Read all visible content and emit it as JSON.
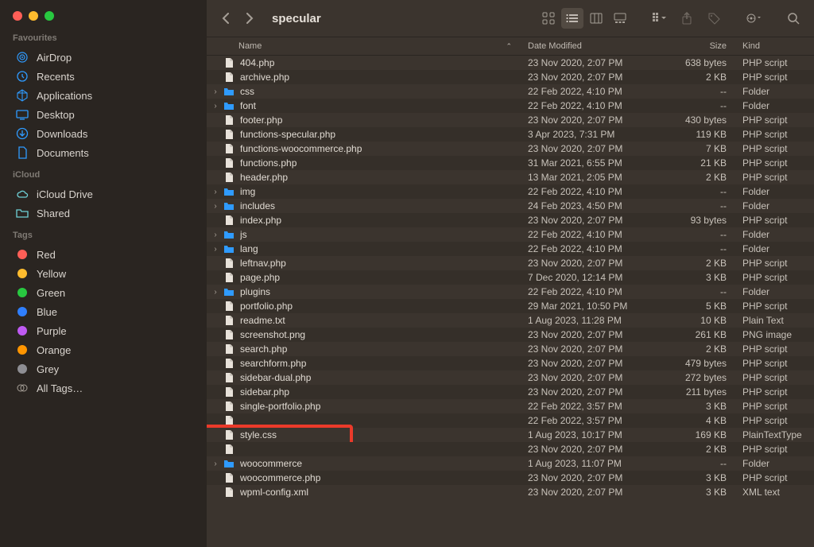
{
  "traffic": {
    "close": "#ff5f57",
    "min": "#febc2e",
    "max": "#28c840"
  },
  "sidebar": {
    "sections": [
      {
        "label": "Favourites",
        "items": [
          {
            "name": "AirDrop",
            "icon": "airdrop",
            "color": "#2f9bff"
          },
          {
            "name": "Recents",
            "icon": "clock",
            "color": "#2f9bff"
          },
          {
            "name": "Applications",
            "icon": "apps",
            "color": "#2f9bff"
          },
          {
            "name": "Desktop",
            "icon": "desktop",
            "color": "#2f9bff"
          },
          {
            "name": "Downloads",
            "icon": "download",
            "color": "#2f9bff"
          },
          {
            "name": "Documents",
            "icon": "document",
            "color": "#2f9bff"
          }
        ]
      },
      {
        "label": "iCloud",
        "items": [
          {
            "name": "iCloud Drive",
            "icon": "cloud",
            "color": "#6fd2d8"
          },
          {
            "name": "Shared",
            "icon": "folder",
            "color": "#6fd2d8"
          }
        ]
      },
      {
        "label": "Tags",
        "items": [
          {
            "name": "Red",
            "icon": "tag",
            "color": "#ff5f57"
          },
          {
            "name": "Yellow",
            "icon": "tag",
            "color": "#febc2e"
          },
          {
            "name": "Green",
            "icon": "tag",
            "color": "#28c840"
          },
          {
            "name": "Blue",
            "icon": "tag",
            "color": "#2f7fff"
          },
          {
            "name": "Purple",
            "icon": "tag",
            "color": "#bf5af2"
          },
          {
            "name": "Orange",
            "icon": "tag",
            "color": "#ff9500"
          },
          {
            "name": "Grey",
            "icon": "tag",
            "color": "#8e8e93"
          },
          {
            "name": "All Tags…",
            "icon": "alltags",
            "color": "#a69f97"
          }
        ]
      }
    ]
  },
  "toolbar": {
    "title": "specular"
  },
  "columns": {
    "name": "Name",
    "date": "Date Modified",
    "size": "Size",
    "kind": "Kind"
  },
  "files": [
    {
      "name": "404.php",
      "date": "23 Nov 2020, 2:07 PM",
      "size": "638 bytes",
      "kind": "PHP script",
      "type": "file"
    },
    {
      "name": "archive.php",
      "date": "23 Nov 2020, 2:07 PM",
      "size": "2 KB",
      "kind": "PHP script",
      "type": "file"
    },
    {
      "name": "css",
      "date": "22 Feb 2022, 4:10 PM",
      "size": "--",
      "kind": "Folder",
      "type": "folder",
      "disclosure": true
    },
    {
      "name": "font",
      "date": "22 Feb 2022, 4:10 PM",
      "size": "--",
      "kind": "Folder",
      "type": "folder",
      "disclosure": true
    },
    {
      "name": "footer.php",
      "date": "23 Nov 2020, 2:07 PM",
      "size": "430 bytes",
      "kind": "PHP script",
      "type": "file"
    },
    {
      "name": "functions-specular.php",
      "date": "3 Apr 2023, 7:31 PM",
      "size": "119 KB",
      "kind": "PHP script",
      "type": "file"
    },
    {
      "name": "functions-woocommerce.php",
      "date": "23 Nov 2020, 2:07 PM",
      "size": "7 KB",
      "kind": "PHP script",
      "type": "file"
    },
    {
      "name": "functions.php",
      "date": "31 Mar 2021, 6:55 PM",
      "size": "21 KB",
      "kind": "PHP script",
      "type": "file"
    },
    {
      "name": "header.php",
      "date": "13 Mar 2021, 2:05 PM",
      "size": "2 KB",
      "kind": "PHP script",
      "type": "file"
    },
    {
      "name": "img",
      "date": "22 Feb 2022, 4:10 PM",
      "size": "--",
      "kind": "Folder",
      "type": "folder",
      "disclosure": true
    },
    {
      "name": "includes",
      "date": "24 Feb 2023, 4:50 PM",
      "size": "--",
      "kind": "Folder",
      "type": "folder",
      "disclosure": true
    },
    {
      "name": "index.php",
      "date": "23 Nov 2020, 2:07 PM",
      "size": "93 bytes",
      "kind": "PHP script",
      "type": "file"
    },
    {
      "name": "js",
      "date": "22 Feb 2022, 4:10 PM",
      "size": "--",
      "kind": "Folder",
      "type": "folder",
      "disclosure": true
    },
    {
      "name": "lang",
      "date": "22 Feb 2022, 4:10 PM",
      "size": "--",
      "kind": "Folder",
      "type": "folder",
      "disclosure": true
    },
    {
      "name": "leftnav.php",
      "date": "23 Nov 2020, 2:07 PM",
      "size": "2 KB",
      "kind": "PHP script",
      "type": "file"
    },
    {
      "name": "page.php",
      "date": "7 Dec 2020, 12:14 PM",
      "size": "3 KB",
      "kind": "PHP script",
      "type": "file"
    },
    {
      "name": "plugins",
      "date": "22 Feb 2022, 4:10 PM",
      "size": "--",
      "kind": "Folder",
      "type": "folder",
      "disclosure": true
    },
    {
      "name": "portfolio.php",
      "date": "29 Mar 2021, 10:50 PM",
      "size": "5 KB",
      "kind": "PHP script",
      "type": "file"
    },
    {
      "name": "readme.txt",
      "date": "1 Aug 2023, 11:28 PM",
      "size": "10 KB",
      "kind": "Plain Text",
      "type": "file"
    },
    {
      "name": "screenshot.png",
      "date": "23 Nov 2020, 2:07 PM",
      "size": "261 KB",
      "kind": "PNG image",
      "type": "file"
    },
    {
      "name": "search.php",
      "date": "23 Nov 2020, 2:07 PM",
      "size": "2 KB",
      "kind": "PHP script",
      "type": "file"
    },
    {
      "name": "searchform.php",
      "date": "23 Nov 2020, 2:07 PM",
      "size": "479 bytes",
      "kind": "PHP script",
      "type": "file"
    },
    {
      "name": "sidebar-dual.php",
      "date": "23 Nov 2020, 2:07 PM",
      "size": "272 bytes",
      "kind": "PHP script",
      "type": "file"
    },
    {
      "name": "sidebar.php",
      "date": "23 Nov 2020, 2:07 PM",
      "size": "211 bytes",
      "kind": "PHP script",
      "type": "file"
    },
    {
      "name": "single-portfolio.php",
      "date": "22 Feb 2022, 3:57 PM",
      "size": "3 KB",
      "kind": "PHP script",
      "type": "file"
    },
    {
      "name": "",
      "date": "22 Feb 2022, 3:57 PM",
      "size": "4 KB",
      "kind": "PHP script",
      "type": "file",
      "hiddenName": true
    },
    {
      "name": "style.css",
      "date": "1 Aug 2023, 10:17 PM",
      "size": "169 KB",
      "kind": "PlainTextType",
      "type": "file",
      "highlight": true
    },
    {
      "name": "",
      "date": "23 Nov 2020, 2:07 PM",
      "size": "2 KB",
      "kind": "PHP script",
      "type": "file",
      "hiddenName": true
    },
    {
      "name": "woocommerce",
      "date": "1 Aug 2023, 11:07 PM",
      "size": "--",
      "kind": "Folder",
      "type": "folder",
      "disclosure": true
    },
    {
      "name": "woocommerce.php",
      "date": "23 Nov 2020, 2:07 PM",
      "size": "3 KB",
      "kind": "PHP script",
      "type": "file"
    },
    {
      "name": "wpml-config.xml",
      "date": "23 Nov 2020, 2:07 PM",
      "size": "3 KB",
      "kind": "XML text",
      "type": "file"
    }
  ]
}
